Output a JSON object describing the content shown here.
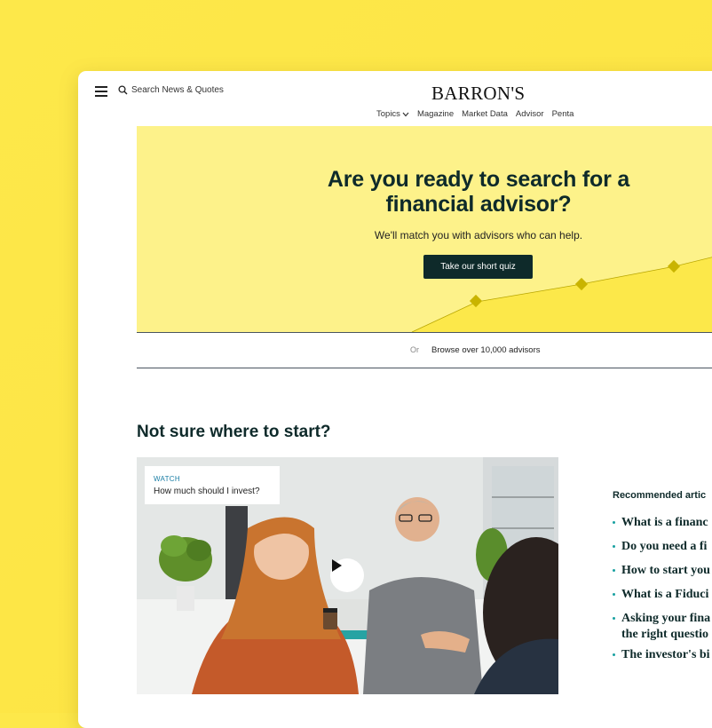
{
  "header": {
    "search_label": "Search News & Quotes",
    "logo": "BARRON'S",
    "nav": [
      {
        "label": "Topics"
      },
      {
        "label": "Magazine"
      },
      {
        "label": "Market Data"
      },
      {
        "label": "Advisor"
      },
      {
        "label": "Penta"
      }
    ]
  },
  "hero": {
    "title": "Are you ready to search for a financial advisor?",
    "subtitle": "We'll match you with advisors who can help.",
    "cta": "Take our short quiz"
  },
  "browse": {
    "or": "Or",
    "link": "Browse over 10,000 advisors"
  },
  "section": {
    "title": "Not sure where to start?"
  },
  "video": {
    "label": "WATCH",
    "title": "How much should I invest?"
  },
  "recommended": {
    "heading": "Recommended artic",
    "items": [
      "What is a financ",
      "Do you need a fi",
      "How to start you",
      "What is a Fiduci",
      "Asking your fina",
      "the right questio",
      "The investor's bi"
    ]
  },
  "colors": {
    "background": "#fde545",
    "hero_bg": "#fdf28a",
    "accent_dark": "#0e2a2a",
    "link_blue": "#1a7ea5",
    "marker": "#c9b400"
  }
}
